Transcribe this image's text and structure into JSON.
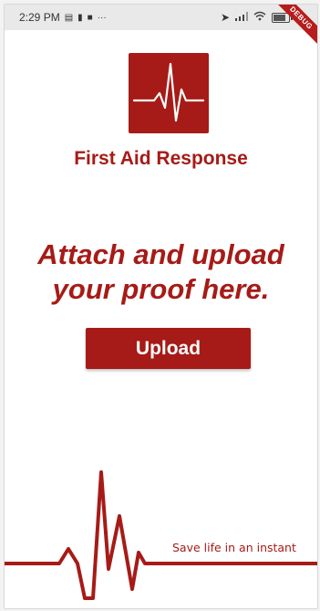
{
  "status_bar": {
    "time": "2:29 PM",
    "left_icons": [
      "message-icon",
      "trash-icon",
      "video-icon",
      "more-icon"
    ],
    "right_icons": [
      "location-icon",
      "signal-icon",
      "wifi-icon",
      "battery-icon"
    ],
    "debug_banner": "DEBUG"
  },
  "app": {
    "title": "First Aid Response",
    "logo_icon": "heartbeat-icon",
    "brand_color": "#a61b17"
  },
  "main": {
    "headline_line1": "Attach and upload",
    "headline_line2": "your proof here.",
    "upload_label": "Upload"
  },
  "footer": {
    "tagline": "Save life in an instant",
    "decoration_icon": "heartbeat-line-icon"
  }
}
